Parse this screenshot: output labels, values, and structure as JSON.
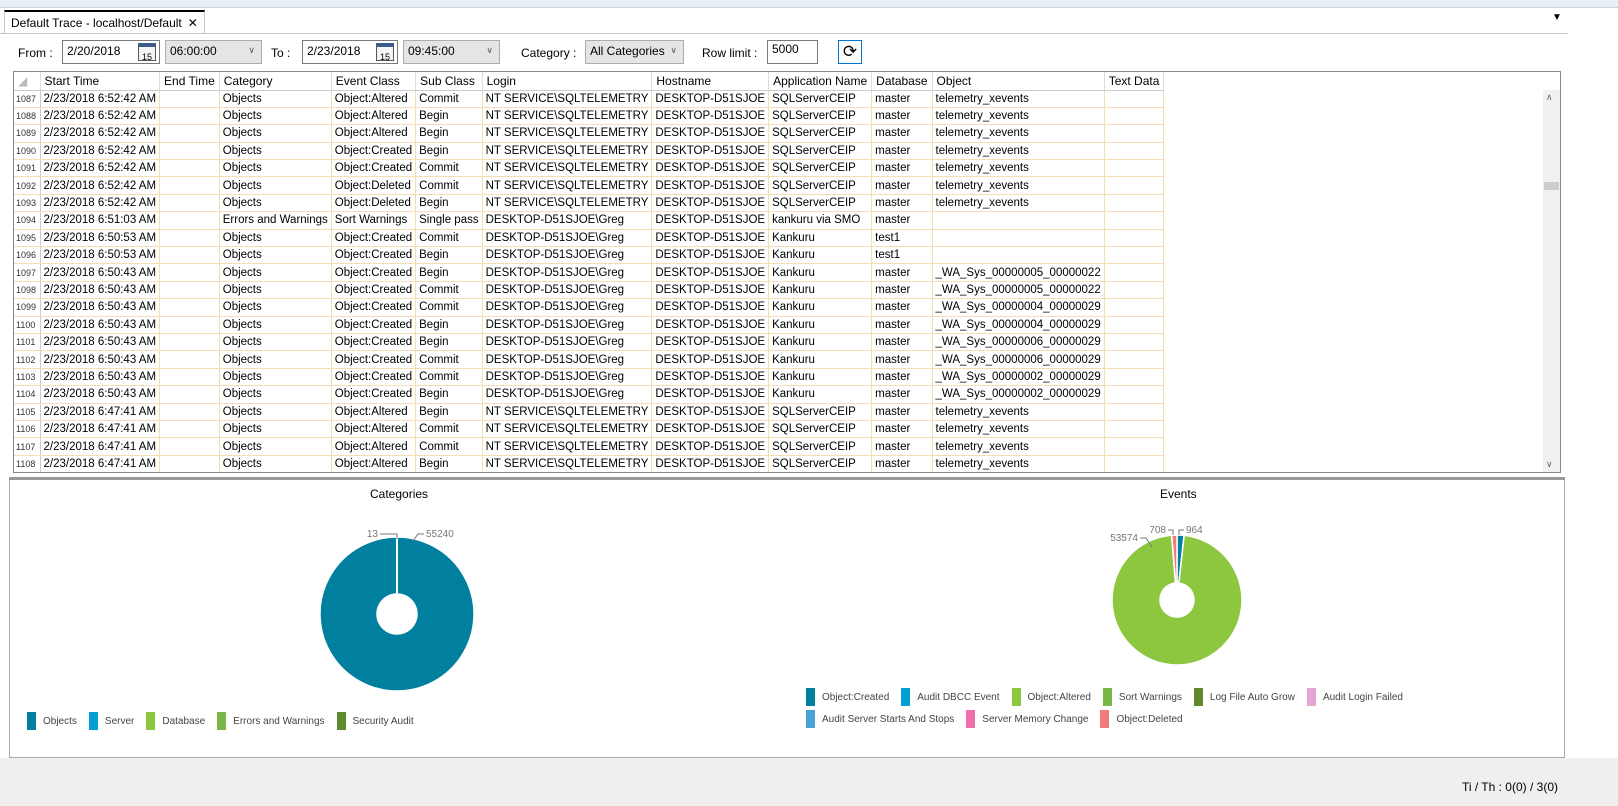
{
  "tab": {
    "title": "Default Trace - localhost/Default",
    "close": "✕"
  },
  "filters": {
    "from_label": "From :",
    "from_date": "2/20/2018",
    "from_time": "06:00:00",
    "to_label": "To :",
    "to_date": "2/23/2018",
    "to_time": "09:45:00",
    "category_label": "Category :",
    "category_value": "All Categories",
    "row_limit_label": "Row limit :",
    "row_limit_value": "5000",
    "calendar_day": "15"
  },
  "grid": {
    "columns": [
      "Start Time",
      "End Time",
      "Category",
      "Event Class",
      "Sub Class",
      "Login",
      "Hostname",
      "Application Name",
      "Database",
      "Object",
      "Text Data"
    ],
    "rows": [
      [
        "1087",
        "2/23/2018 6:52:42 AM",
        "",
        "Objects",
        "Object:Altered",
        "Commit",
        "NT SERVICE\\SQLTELEMETRY",
        "DESKTOP-D51SJOE",
        "SQLServerCEIP",
        "master",
        "telemetry_xevents",
        ""
      ],
      [
        "1088",
        "2/23/2018 6:52:42 AM",
        "",
        "Objects",
        "Object:Altered",
        "Begin",
        "NT SERVICE\\SQLTELEMETRY",
        "DESKTOP-D51SJOE",
        "SQLServerCEIP",
        "master",
        "telemetry_xevents",
        ""
      ],
      [
        "1089",
        "2/23/2018 6:52:42 AM",
        "",
        "Objects",
        "Object:Altered",
        "Begin",
        "NT SERVICE\\SQLTELEMETRY",
        "DESKTOP-D51SJOE",
        "SQLServerCEIP",
        "master",
        "telemetry_xevents",
        ""
      ],
      [
        "1090",
        "2/23/2018 6:52:42 AM",
        "",
        "Objects",
        "Object:Created",
        "Begin",
        "NT SERVICE\\SQLTELEMETRY",
        "DESKTOP-D51SJOE",
        "SQLServerCEIP",
        "master",
        "telemetry_xevents",
        ""
      ],
      [
        "1091",
        "2/23/2018 6:52:42 AM",
        "",
        "Objects",
        "Object:Created",
        "Commit",
        "NT SERVICE\\SQLTELEMETRY",
        "DESKTOP-D51SJOE",
        "SQLServerCEIP",
        "master",
        "telemetry_xevents",
        ""
      ],
      [
        "1092",
        "2/23/2018 6:52:42 AM",
        "",
        "Objects",
        "Object:Deleted",
        "Commit",
        "NT SERVICE\\SQLTELEMETRY",
        "DESKTOP-D51SJOE",
        "SQLServerCEIP",
        "master",
        "telemetry_xevents",
        ""
      ],
      [
        "1093",
        "2/23/2018 6:52:42 AM",
        "",
        "Objects",
        "Object:Deleted",
        "Begin",
        "NT SERVICE\\SQLTELEMETRY",
        "DESKTOP-D51SJOE",
        "SQLServerCEIP",
        "master",
        "telemetry_xevents",
        ""
      ],
      [
        "1094",
        "2/23/2018 6:51:03 AM",
        "",
        "Errors and Warnings",
        "Sort Warnings",
        "Single pass",
        "DESKTOP-D51SJOE\\Greg",
        "DESKTOP-D51SJOE",
        "kankuru via SMO",
        "master",
        "",
        ""
      ],
      [
        "1095",
        "2/23/2018 6:50:53 AM",
        "",
        "Objects",
        "Object:Created",
        "Commit",
        "DESKTOP-D51SJOE\\Greg",
        "DESKTOP-D51SJOE",
        "Kankuru",
        "test1",
        "",
        ""
      ],
      [
        "1096",
        "2/23/2018 6:50:53 AM",
        "",
        "Objects",
        "Object:Created",
        "Begin",
        "DESKTOP-D51SJOE\\Greg",
        "DESKTOP-D51SJOE",
        "Kankuru",
        "test1",
        "",
        ""
      ],
      [
        "1097",
        "2/23/2018 6:50:43 AM",
        "",
        "Objects",
        "Object:Created",
        "Begin",
        "DESKTOP-D51SJOE\\Greg",
        "DESKTOP-D51SJOE",
        "Kankuru",
        "master",
        "_WA_Sys_00000005_00000022",
        ""
      ],
      [
        "1098",
        "2/23/2018 6:50:43 AM",
        "",
        "Objects",
        "Object:Created",
        "Commit",
        "DESKTOP-D51SJOE\\Greg",
        "DESKTOP-D51SJOE",
        "Kankuru",
        "master",
        "_WA_Sys_00000005_00000022",
        ""
      ],
      [
        "1099",
        "2/23/2018 6:50:43 AM",
        "",
        "Objects",
        "Object:Created",
        "Commit",
        "DESKTOP-D51SJOE\\Greg",
        "DESKTOP-D51SJOE",
        "Kankuru",
        "master",
        "_WA_Sys_00000004_00000029",
        ""
      ],
      [
        "1100",
        "2/23/2018 6:50:43 AM",
        "",
        "Objects",
        "Object:Created",
        "Begin",
        "DESKTOP-D51SJOE\\Greg",
        "DESKTOP-D51SJOE",
        "Kankuru",
        "master",
        "_WA_Sys_00000004_00000029",
        ""
      ],
      [
        "1101",
        "2/23/2018 6:50:43 AM",
        "",
        "Objects",
        "Object:Created",
        "Begin",
        "DESKTOP-D51SJOE\\Greg",
        "DESKTOP-D51SJOE",
        "Kankuru",
        "master",
        "_WA_Sys_00000006_00000029",
        ""
      ],
      [
        "1102",
        "2/23/2018 6:50:43 AM",
        "",
        "Objects",
        "Object:Created",
        "Commit",
        "DESKTOP-D51SJOE\\Greg",
        "DESKTOP-D51SJOE",
        "Kankuru",
        "master",
        "_WA_Sys_00000006_00000029",
        ""
      ],
      [
        "1103",
        "2/23/2018 6:50:43 AM",
        "",
        "Objects",
        "Object:Created",
        "Commit",
        "DESKTOP-D51SJOE\\Greg",
        "DESKTOP-D51SJOE",
        "Kankuru",
        "master",
        "_WA_Sys_00000002_00000029",
        ""
      ],
      [
        "1104",
        "2/23/2018 6:50:43 AM",
        "",
        "Objects",
        "Object:Created",
        "Begin",
        "DESKTOP-D51SJOE\\Greg",
        "DESKTOP-D51SJOE",
        "Kankuru",
        "master",
        "_WA_Sys_00000002_00000029",
        ""
      ],
      [
        "1105",
        "2/23/2018 6:47:41 AM",
        "",
        "Objects",
        "Object:Altered",
        "Begin",
        "NT SERVICE\\SQLTELEMETRY",
        "DESKTOP-D51SJOE",
        "SQLServerCEIP",
        "master",
        "telemetry_xevents",
        ""
      ],
      [
        "1106",
        "2/23/2018 6:47:41 AM",
        "",
        "Objects",
        "Object:Altered",
        "Commit",
        "NT SERVICE\\SQLTELEMETRY",
        "DESKTOP-D51SJOE",
        "SQLServerCEIP",
        "master",
        "telemetry_xevents",
        ""
      ],
      [
        "1107",
        "2/23/2018 6:47:41 AM",
        "",
        "Objects",
        "Object:Altered",
        "Commit",
        "NT SERVICE\\SQLTELEMETRY",
        "DESKTOP-D51SJOE",
        "SQLServerCEIP",
        "master",
        "telemetry_xevents",
        ""
      ],
      [
        "1108",
        "2/23/2018 6:47:41 AM",
        "",
        "Objects",
        "Object:Altered",
        "Begin",
        "NT SERVICE\\SQLTELEMETRY",
        "DESKTOP-D51SJOE",
        "SQLServerCEIP",
        "master",
        "telemetry_xevents",
        ""
      ]
    ]
  },
  "chart_data": [
    {
      "type": "pie",
      "donut": true,
      "title": "Categories",
      "categories": [
        "Objects",
        "Server",
        "Database",
        "Errors and Warnings",
        "Security Audit"
      ],
      "values": [
        55240,
        1,
        3,
        13,
        1
      ],
      "data_labels": [
        "55240",
        "13"
      ],
      "colors": [
        "#00809e",
        "#00a0d2",
        "#8dc63f",
        "#7ab648",
        "#5f8a2e"
      ],
      "legend": "bottom-left"
    },
    {
      "type": "pie",
      "donut": true,
      "title": "Events",
      "categories": [
        "Object:Created",
        "Audit DBCC Event",
        "Object:Altered",
        "Sort Warnings",
        "Log File Auto Grow",
        "Audit Login Failed",
        "Audit Server Starts And Stops",
        "Server Memory Change",
        "Object:Deleted"
      ],
      "values": [
        964,
        9,
        53574,
        13,
        1,
        1,
        1,
        1,
        708
      ],
      "data_labels": [
        "964",
        "53574",
        "708"
      ],
      "colors": [
        "#00809e",
        "#00a0d2",
        "#8dc63f",
        "#7ab648",
        "#5f8a2e",
        "#e3a7d4",
        "#4aa3d4",
        "#f06ea9",
        "#f47a7a"
      ],
      "legend": "bottom"
    }
  ],
  "status": {
    "text": "Ti / Th : 0(0) / 3(0)"
  }
}
